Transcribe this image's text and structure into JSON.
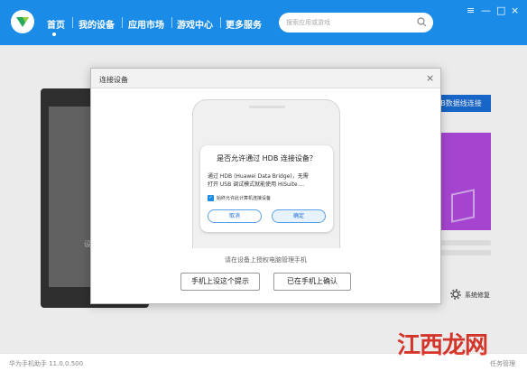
{
  "nav": {
    "items": [
      "首页",
      "我的设备",
      "应用市场",
      "游戏中心",
      "更多服务"
    ],
    "active": "首页"
  },
  "search": {
    "placeholder": "搜索应用或游戏",
    "icon": "search-icon"
  },
  "window_controls": {
    "menu": "≡",
    "minimize": "—",
    "maximize": "□",
    "close": "×"
  },
  "device": {
    "text": "设备"
  },
  "background": {
    "hdb_button": "B数据线连接",
    "repair_label": "系统修复"
  },
  "dialog": {
    "title": "连接设备",
    "close": "×",
    "prompt": {
      "title": "是否允许通过 HDB 连接设备？",
      "body_line1": "通过 HDB (Huawei Data Bridge)，无需",
      "body_line2": "打开 USB 调试模式就能使用 HiSuite ...",
      "checkbox_label": "始终允许此计算机连接设备",
      "checkbox_checked": true,
      "cancel": "取消",
      "confirm": "确定"
    },
    "hint": "请在设备上授权电脑管理手机",
    "button_no_prompt": "手机上没这个提示",
    "button_confirmed": "已在手机上确认"
  },
  "status": {
    "version": "华为手机助手 11.0.0.500",
    "tasks": "任务管理"
  },
  "watermark": {
    "main": "江西龙网",
    "sub": ""
  },
  "colors": {
    "brand": "#1a8be6",
    "button_blue": "#1a6ed8",
    "card": "#b44be1",
    "watermark": "#e53a2e"
  }
}
